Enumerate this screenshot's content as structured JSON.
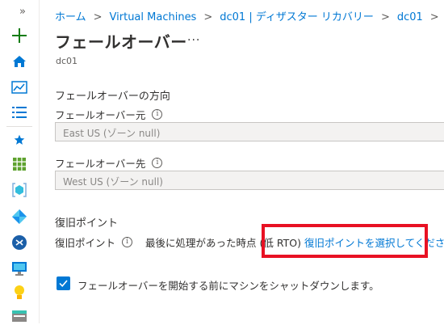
{
  "sidebar": {
    "expand_glyph": "»",
    "items": [
      {
        "icon": "create-resource-icon"
      },
      {
        "icon": "home-icon"
      },
      {
        "icon": "dashboard-icon"
      },
      {
        "icon": "all-services-icon"
      },
      {
        "icon": "favorites-star-icon"
      },
      {
        "icon": "all-resources-icon"
      },
      {
        "icon": "resource-groups-icon"
      },
      {
        "icon": "app-services-icon"
      },
      {
        "icon": "sql-databases-icon"
      },
      {
        "icon": "virtual-machines-icon"
      },
      {
        "icon": "advisor-icon"
      },
      {
        "icon": "storage-icon"
      }
    ]
  },
  "breadcrumb": [
    "ホーム",
    "Virtual Machines",
    "dc01 | ディザスター リカバリー",
    "dc01"
  ],
  "breadcrumb_separator": ">",
  "page": {
    "title": "フェールオーバー",
    "more_label": "···",
    "subtitle": "dc01"
  },
  "failover_direction": {
    "section_title": "フェールオーバーの方向",
    "source_label": "フェールオーバー元",
    "source_value": "East US (ゾーン null)",
    "target_label": "フェールオーバー先",
    "target_value": "West US (ゾーン null)"
  },
  "recovery_point": {
    "section_title": "復旧ポイント",
    "label": "復旧ポイント",
    "value": "最後に処理があった時点 (低 RTO)",
    "select_link": "復旧ポイントを選択してください"
  },
  "shutdown": {
    "checked": true,
    "label": "フェールオーバーを開始する前にマシンをシャットダウンします。"
  },
  "colors": {
    "accent": "#0078d4",
    "highlight": "#e81123",
    "create_green": "#107c10"
  }
}
